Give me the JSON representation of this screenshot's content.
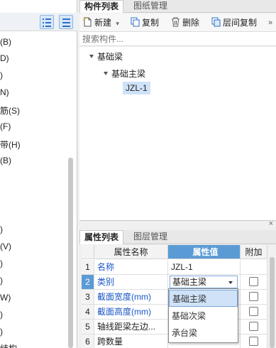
{
  "left_panel": {
    "items": [
      "(B)",
      "D)",
      ")",
      "N)",
      "筋(S)",
      "(F)",
      "带(H)",
      "(B)",
      ")",
      "(V)",
      ")",
      ")",
      "W)",
      ")",
      ")",
      "",
      "结构"
    ]
  },
  "component_list": {
    "tabs": [
      "构件列表",
      "图纸管理"
    ],
    "toolbar": {
      "new_label": "新建",
      "copy_label": "复制",
      "delete_label": "删除",
      "floor_copy_label": "层间复制",
      "more_label": "»"
    },
    "search_placeholder": "搜索构件...",
    "tree": {
      "root": "基础梁",
      "child": "基础主梁",
      "leaf": "JZL-1"
    }
  },
  "property_list": {
    "close_label": "×",
    "tabs": [
      "属性列表",
      "图层管理"
    ],
    "columns": [
      "",
      "属性名称",
      "属性值",
      "附加"
    ],
    "rows": [
      {
        "num": "1",
        "name": "名称",
        "value": "JZL-1",
        "blue": true,
        "check": false
      },
      {
        "num": "2",
        "name": "类别",
        "value": "基础主梁",
        "blue": true,
        "check": true
      },
      {
        "num": "3",
        "name": "截面宽度(mm)",
        "value": "",
        "blue": true,
        "check": true
      },
      {
        "num": "4",
        "name": "截面高度(mm)",
        "value": "",
        "blue": true,
        "check": true
      },
      {
        "num": "5",
        "name": "轴线距梁左边...",
        "value": "",
        "blue": false,
        "check": true
      },
      {
        "num": "6",
        "name": "跨数量",
        "value": "",
        "blue": false,
        "check": true
      }
    ],
    "dropdown_options": [
      "基础主梁",
      "基础次梁",
      "承台梁"
    ]
  },
  "colors": {
    "accent": "#5b9bd5",
    "link_blue": "#1a55c6",
    "selection": "#cfe2f8"
  }
}
